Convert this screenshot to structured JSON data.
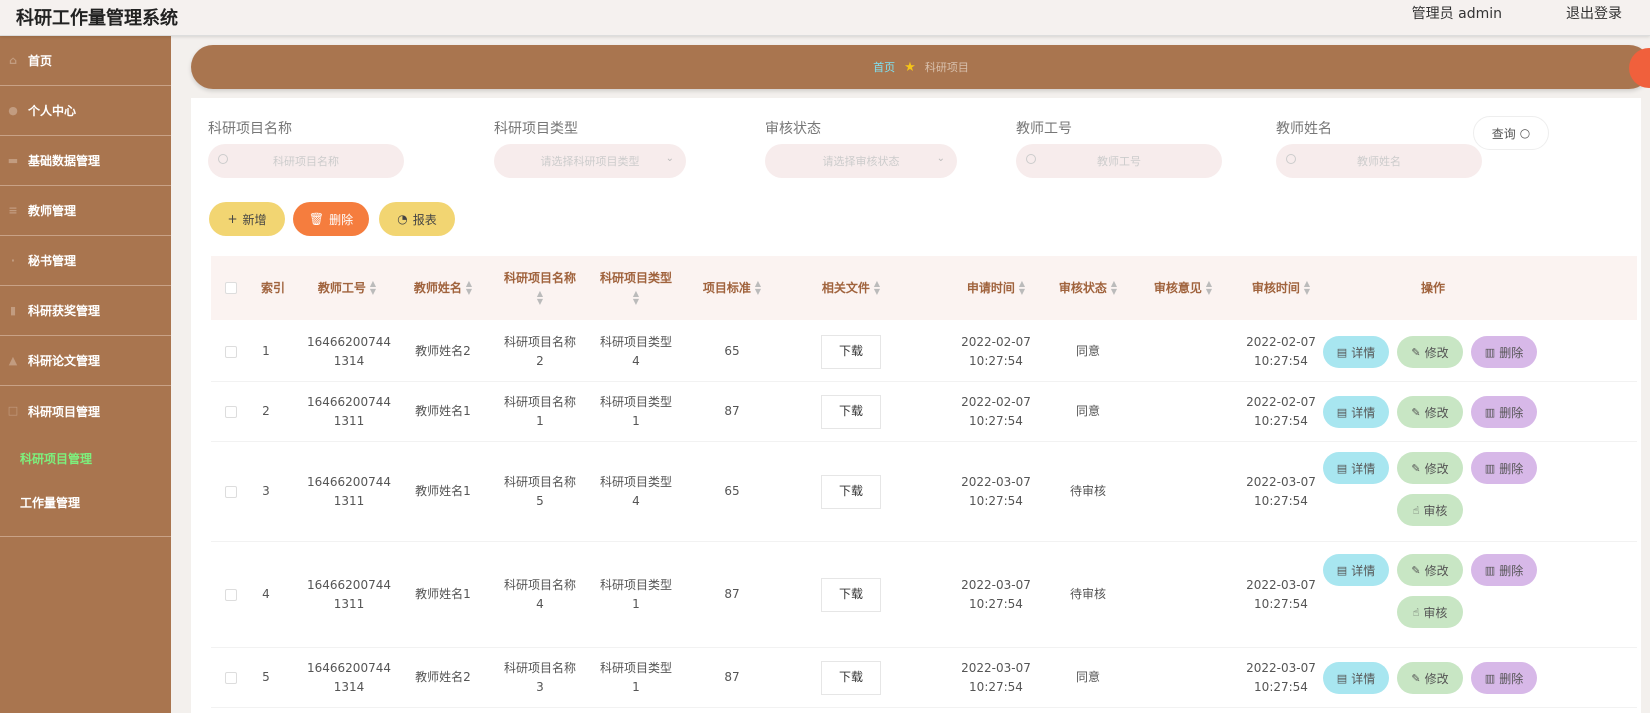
{
  "header": {
    "app_title": "科研工作量管理系统",
    "user": "管理员 admin",
    "logout": "退出登录"
  },
  "sidebar": {
    "items": [
      {
        "label": "首页",
        "icon": "home-icon"
      },
      {
        "label": "个人中心",
        "icon": "user-icon"
      },
      {
        "label": "基础数据管理",
        "icon": "data-icon"
      },
      {
        "label": "教师管理",
        "icon": "list-icon"
      },
      {
        "label": "秘书管理",
        "icon": "user-icon"
      },
      {
        "label": "科研获奖管理",
        "icon": "award-icon"
      },
      {
        "label": "科研论文管理",
        "icon": "paper-icon"
      },
      {
        "label": "科研项目管理",
        "icon": "project-icon"
      }
    ],
    "subitems": [
      {
        "label": "科研项目管理",
        "active": true
      },
      {
        "label": "工作量管理",
        "active": false
      }
    ]
  },
  "breadcrumb": {
    "home": "首页",
    "current": "科研项目"
  },
  "search": {
    "fields": [
      {
        "label": "科研项目名称",
        "placeholder": "科研项目名称"
      },
      {
        "label": "科研项目类型",
        "placeholder": "请选择科研项目类型"
      },
      {
        "label": "审核状态",
        "placeholder": "请选择审核状态"
      },
      {
        "label": "教师工号",
        "placeholder": "教师工号"
      },
      {
        "label": "教师姓名",
        "placeholder": "教师姓名"
      }
    ],
    "query_label": "查询"
  },
  "actions": {
    "add": "新增",
    "delete": "删除",
    "report": "报表"
  },
  "table": {
    "headers": {
      "index": "索引",
      "teacher_no": "教师工号",
      "teacher_name": "教师姓名",
      "project_name": "科研项目名称",
      "project_type": "科研项目类型",
      "standard": "项目标准",
      "file": "相关文件",
      "apply_time": "申请时间",
      "status": "审核状态",
      "opinion": "审核意见",
      "audit_time": "审核时间",
      "ops": "操作"
    },
    "download_label": "下载",
    "op_labels": {
      "detail": "详情",
      "edit": "修改",
      "delete": "删除",
      "audit": "审核"
    },
    "rows": [
      {
        "index": "1",
        "teacher_no_a": "16466200744",
        "teacher_no_b": "1314",
        "teacher_name": "教师姓名2",
        "project_name_a": "科研项目名称",
        "project_name_b": "2",
        "project_type_a": "科研项目类型",
        "project_type_b": "4",
        "standard": "65",
        "apply_date": "2022-02-07",
        "apply_clock": "10:27:54",
        "status": "同意",
        "opinion": "",
        "audit_date": "2022-02-07",
        "audit_clock": "10:27:54"
      },
      {
        "index": "2",
        "teacher_no_a": "16466200744",
        "teacher_no_b": "1311",
        "teacher_name": "教师姓名1",
        "project_name_a": "科研项目名称",
        "project_name_b": "1",
        "project_type_a": "科研项目类型",
        "project_type_b": "1",
        "standard": "87",
        "apply_date": "2022-02-07",
        "apply_clock": "10:27:54",
        "status": "同意",
        "opinion": "",
        "audit_date": "2022-02-07",
        "audit_clock": "10:27:54"
      },
      {
        "index": "3",
        "teacher_no_a": "16466200744",
        "teacher_no_b": "1311",
        "teacher_name": "教师姓名1",
        "project_name_a": "科研项目名称",
        "project_name_b": "5",
        "project_type_a": "科研项目类型",
        "project_type_b": "4",
        "standard": "65",
        "apply_date": "2022-03-07",
        "apply_clock": "10:27:54",
        "status": "待审核",
        "opinion": "",
        "audit_date": "2022-03-07",
        "audit_clock": "10:27:54"
      },
      {
        "index": "4",
        "teacher_no_a": "16466200744",
        "teacher_no_b": "1311",
        "teacher_name": "教师姓名1",
        "project_name_a": "科研项目名称",
        "project_name_b": "4",
        "project_type_a": "科研项目类型",
        "project_type_b": "1",
        "standard": "87",
        "apply_date": "2022-03-07",
        "apply_clock": "10:27:54",
        "status": "待审核",
        "opinion": "",
        "audit_date": "2022-03-07",
        "audit_clock": "10:27:54"
      },
      {
        "index": "5",
        "teacher_no_a": "16466200744",
        "teacher_no_b": "1314",
        "teacher_name": "教师姓名2",
        "project_name_a": "科研项目名称",
        "project_name_b": "3",
        "project_type_a": "科研项目类型",
        "project_type_b": "1",
        "standard": "87",
        "apply_date": "2022-03-07",
        "apply_clock": "10:27:54",
        "status": "同意",
        "opinion": "",
        "audit_date": "2022-03-07",
        "audit_clock": "10:27:54"
      }
    ]
  },
  "colors": {
    "sidebar": "#a9754f",
    "accent_green": "#7df07d",
    "header_text": "#a0633d"
  }
}
